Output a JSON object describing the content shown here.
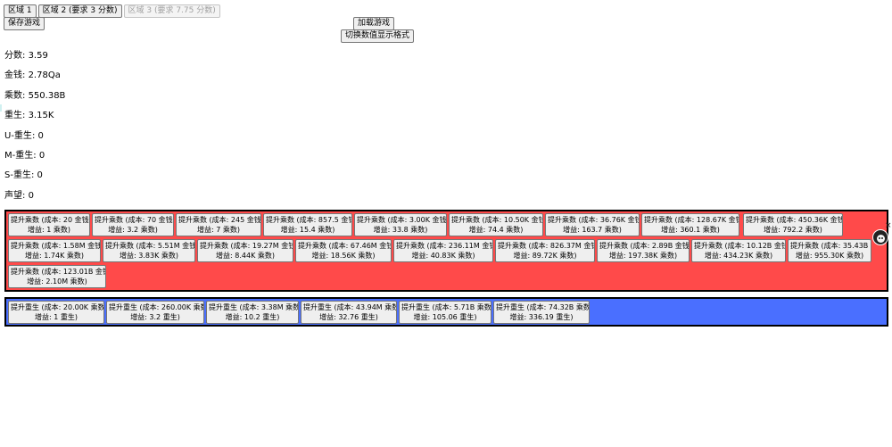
{
  "tabs": [
    {
      "label": "区域 1",
      "disabled": false
    },
    {
      "label": "区域 2 (要求 3 分数)",
      "disabled": false
    },
    {
      "label": "区域 3 (要求 7.75 分数)",
      "disabled": true
    }
  ],
  "actions": {
    "save_label": "保存游戏",
    "load_label": "加载游戏",
    "format_label": "切换数值显示格式"
  },
  "stats": [
    {
      "label": "分数",
      "value": "3.59"
    },
    {
      "label": "金钱",
      "value": "2.78Qa"
    },
    {
      "label": "乘数",
      "value": "550.38B"
    },
    {
      "label": "重生",
      "value": "3.15K"
    },
    {
      "label": "U-重生",
      "value": "0"
    },
    {
      "label": "M-重生",
      "value": "0"
    },
    {
      "label": "S-重生",
      "value": "0"
    },
    {
      "label": "声望",
      "value": "0"
    }
  ],
  "multiplier_upgrades": [
    {
      "line1": "提升乘数 (成本: 20 金钱",
      "line2": "增益: 1 乘数)"
    },
    {
      "line1": "提升乘数 (成本: 70 金钱",
      "line2": "增益: 3.2 乘数)"
    },
    {
      "line1": "提升乘数 (成本: 245 金钱",
      "line2": "增益: 7 乘数)"
    },
    {
      "line1": "提升乘数 (成本: 857.5 金钱",
      "line2": "增益: 15.4 乘数)"
    },
    {
      "line1": "提升乘数 (成本: 3.00K 金钱",
      "line2": "增益: 33.8 乘数)"
    },
    {
      "line1": "提升乘数 (成本: 10.50K 金钱",
      "line2": "增益: 74.4 乘数)"
    },
    {
      "line1": "提升乘数 (成本: 36.76K 金钱",
      "line2": "增益: 163.7 乘数)"
    },
    {
      "line1": "提升乘数 (成本: 128.67K 金钱",
      "line2": "增益: 360.1 乘数)"
    },
    {
      "line1": "提升乘数 (成本: 450.36K 金钱",
      "line2": "增益: 792.2 乘数)"
    },
    {
      "line1": "提升乘数 (成本: 1.58M 金钱",
      "line2": "增益: 1.74K 乘数)"
    },
    {
      "line1": "提升乘数 (成本: 5.51M 金钱",
      "line2": "增益: 3.83K 乘数)"
    },
    {
      "line1": "提升乘数 (成本: 19.27M 金钱",
      "line2": "增益: 8.44K 乘数)"
    },
    {
      "line1": "提升乘数 (成本: 67.46M 金钱",
      "line2": "增益: 18.56K 乘数)"
    },
    {
      "line1": "提升乘数 (成本: 236.11M 金钱",
      "line2": "增益: 40.83K 乘数)"
    },
    {
      "line1": "提升乘数 (成本: 826.37M 金钱",
      "line2": "增益: 89.72K 乘数)"
    },
    {
      "line1": "提升乘数 (成本: 2.89B 金钱",
      "line2": "增益: 197.38K 乘数)"
    },
    {
      "line1": "提升乘数 (成本: 10.12B 金钱",
      "line2": "增益: 434.23K 乘数)"
    },
    {
      "line1": "提升乘数 (成本: 35.43B 金钱",
      "line2": "增益: 955.30K 乘数)"
    },
    {
      "line1": "提升乘数 (成本: 123.01B 金钱",
      "line2": "增益: 2.10M 乘数)"
    }
  ],
  "rebirth_upgrades": [
    {
      "line1": "提升重生 (成本: 20.00K 乘数",
      "line2": "增益: 1 重生)"
    },
    {
      "line1": "提升重生 (成本: 260.00K 乘数",
      "line2": "增益: 3.2 重生)"
    },
    {
      "line1": "提升重生 (成本: 3.38M 乘数",
      "line2": "增益: 10.2 重生)"
    },
    {
      "line1": "提升重生 (成本: 43.94M 乘数",
      "line2": "增益: 32.76 重生)"
    },
    {
      "line1": "提升重生 (成本: 5.71B 乘数",
      "line2": "增益: 105.06 重生)"
    },
    {
      "line1": "提升重生 (成本: 74.32B 乘数",
      "line2": "增益: 336.19 重生)"
    }
  ],
  "colors": {
    "multiplier_zone": "#ff4a4a",
    "rebirth_zone": "#4a6fff"
  },
  "icons": {
    "close": "×",
    "avatar": "avatar-icon"
  }
}
